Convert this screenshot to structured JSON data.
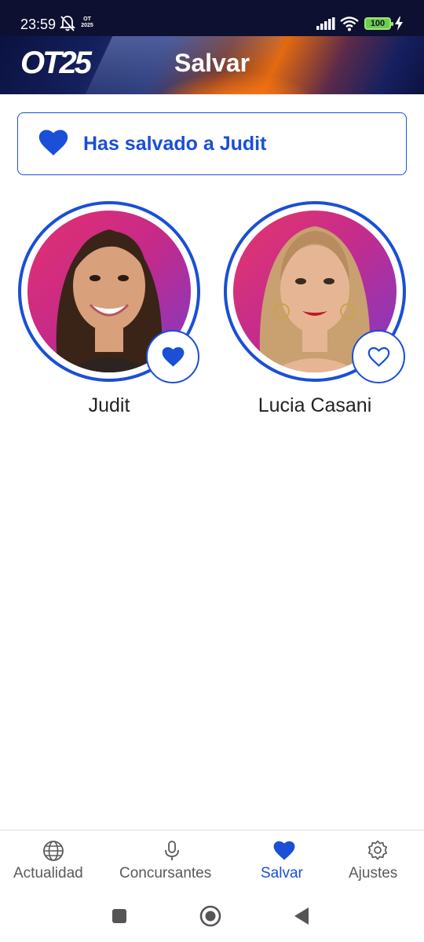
{
  "status_bar": {
    "time": "23:59",
    "battery": "100",
    "mini_logo": "OT 2025",
    "icons": [
      "bell-off-icon",
      "ot-app-icon",
      "signal-icon",
      "wifi-icon",
      "battery-icon",
      "charging-bolt-icon"
    ]
  },
  "header": {
    "logo": "OT25",
    "title": "Salvar"
  },
  "banner": {
    "text": "Has salvado a Judit",
    "icon": "heart-filled-icon"
  },
  "contestants": [
    {
      "name": "Judit",
      "saved": true,
      "icon": "heart-filled-icon"
    },
    {
      "name": "Lucia Casani",
      "saved": false,
      "icon": "heart-outline-icon"
    }
  ],
  "bottom_nav": {
    "items": [
      {
        "label": "Actualidad",
        "icon": "globe-icon",
        "active": false
      },
      {
        "label": "Concursantes",
        "icon": "microphone-icon",
        "active": false
      },
      {
        "label": "Salvar",
        "icon": "heart-icon",
        "active": true
      },
      {
        "label": "Ajustes",
        "icon": "gear-icon",
        "active": false
      }
    ]
  },
  "system_nav": {
    "buttons": [
      "recents-square-icon",
      "home-circle-icon",
      "back-triangle-icon"
    ]
  },
  "colors": {
    "accent": "#1a4fd6",
    "status_bar_bg": "#0d1030",
    "inactive_nav": "#5a5a5a",
    "battery_green": "#6ccf4a"
  }
}
